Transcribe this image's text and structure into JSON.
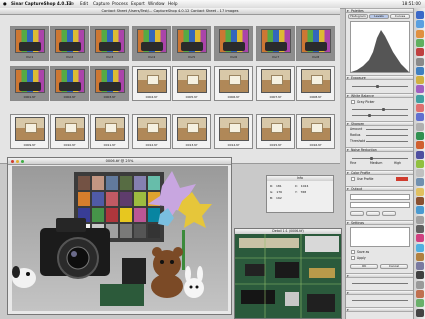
{
  "menubar": {
    "app_name": "Sinar CaptureShop 4.0.12",
    "items": [
      "File",
      "Edit",
      "Capture",
      "Process",
      "Export",
      "Window",
      "Help"
    ],
    "clock": "18:51:00"
  },
  "browser": {
    "title": "Contact Sheet /Users/Test/... CaptureShop 4.0.12 Contact Sheet - 17 images",
    "rows": [
      [
        "Imc1",
        "Imc2",
        "Imc3",
        "Imc4",
        "Imc5",
        "Imc6",
        "Imc7",
        "Imc8"
      ],
      [
        "0001.tif",
        "0002.tif",
        "0003.tif",
        "0004.tif",
        "0005.tif",
        "0006.tif",
        "0007.tif",
        "0008.tif"
      ],
      [
        "0009.tif",
        "0010.tif",
        "0011.tif",
        "0012.tif",
        "0013.tif",
        "0014.tif",
        "0015.tif",
        "0016.tif"
      ]
    ]
  },
  "viewer": {
    "title": "0006.tif @ 25%"
  },
  "info": {
    "title": "Info",
    "rows": [
      [
        "R:",
        "181",
        "X:",
        "1024"
      ],
      [
        "G:",
        "176",
        "Y:",
        "768"
      ],
      [
        "B:",
        "162",
        "",
        ""
      ]
    ]
  },
  "pcb": {
    "title": "Detail 1:1 (0006.tif)"
  },
  "palette": {
    "title": "Palettes",
    "tabs": [
      "Histogram",
      "Levels",
      "Curves"
    ],
    "sections": {
      "exposure": "Exposure",
      "wb": "White Balance",
      "wb_check": "Gray Picker",
      "sharpen": "Sharpen",
      "sharpen_values": [
        "Amount",
        "Radius",
        "Threshold"
      ],
      "noise": "Noise Reduction",
      "noise_values": [
        "Fine",
        "Medium",
        "High"
      ],
      "profile": "Color Profile",
      "profile_check": "Use Profile",
      "output": "Output",
      "settings": "Settings",
      "checks": [
        "Save as",
        "Apply"
      ],
      "buttons": [
        "OK",
        "Cancel"
      ]
    }
  },
  "colors": {
    "accent": "#3a68c8",
    "red": "#d03c2e",
    "green": "#3fae46"
  }
}
